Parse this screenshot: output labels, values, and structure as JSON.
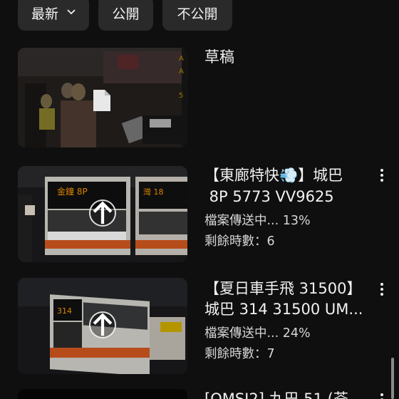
{
  "filters": {
    "sort_label": "最新",
    "public_label": "公開",
    "private_label": "不公開"
  },
  "videos": [
    {
      "title": "草稿",
      "status": "",
      "remaining": ""
    },
    {
      "title_line1": "【東廊特快💨】城巴",
      "title_line2": " 8P 5773 VV9625",
      "status": "檔案傳送中... 13%",
      "remaining": "剩餘時數：6"
    },
    {
      "title_line1": "【夏日車手飛 31500】",
      "title_line2": "城巴 314 31500 UM...",
      "status": "檔案傳送中... 24%",
      "remaining": "剩餘時數：7"
    },
    {
      "title_line1": "[OMSI2] 九巴 51 (荃"
    }
  ],
  "icons": {
    "sort": "chevron-down-icon",
    "draft": "document-icon",
    "upload": "upload-arrow-icon",
    "menu": "more-vert-icon"
  },
  "colors": {
    "background": "#0f0f0f",
    "chip": "#2a2a2a",
    "text": "#f1f1f1"
  }
}
